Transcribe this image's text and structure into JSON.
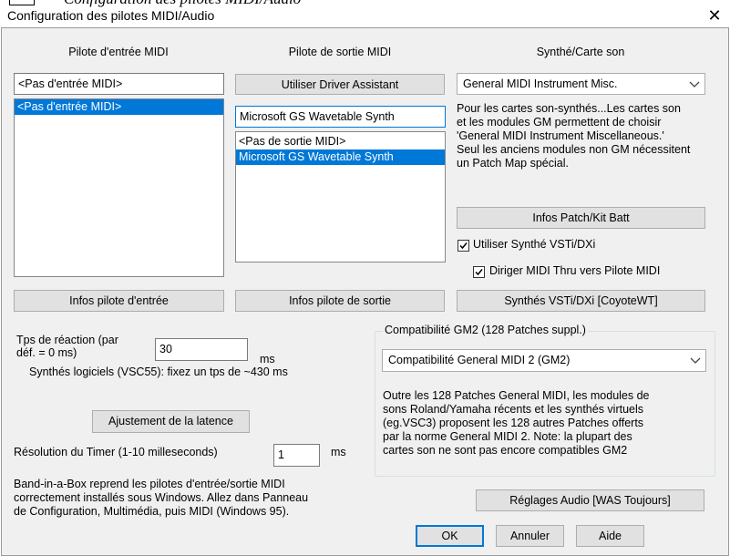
{
  "cut_caption": "Configuration des pilotes MIDI/Audio",
  "window": {
    "title": "Configuration des pilotes MIDI/Audio",
    "close_glyph": "✕"
  },
  "midi_in": {
    "header": "Pilote d'entrée MIDI",
    "value": "<Pas d'entrée MIDI>",
    "items": [
      "<Pas d'entrée MIDI>"
    ],
    "info_button": "Infos pilote d'entrée"
  },
  "midi_out": {
    "header": "Pilote de sortie MIDI",
    "assistant_button": "Utiliser Driver Assistant",
    "value": "Microsoft GS Wavetable Synth",
    "items": [
      "<Pas de sortie MIDI>",
      "Microsoft GS Wavetable Synth"
    ],
    "info_button": "Infos pilote de sortie"
  },
  "synth": {
    "header": "Synthé/Carte son",
    "selected": "General MIDI Instrument Misc.",
    "note_lines": [
      "Pour les cartes son-synthés...Les cartes son",
      "et les modules GM permettent de choisir",
      "'General MIDI  Instrument Miscellaneous.'",
      "Seul les anciens modules non GM nécessitent",
      "un Patch Map spécial."
    ],
    "patch_button": "Infos Patch/Kit Batt",
    "use_vst_label": "Utiliser Synthé VSTi/DXi",
    "use_vst_checked": true,
    "thru_label": "Diriger MIDI Thru vers Pilote MIDI",
    "thru_checked": true,
    "vst_button": "Synthés VSTi/DXi [CoyoteWT]"
  },
  "latency": {
    "label_line1": "Tps de réaction (par",
    "label_line2": "déf. = 0 ms)",
    "value": "30",
    "unit": "ms",
    "hint": "Synthés logiciels (VSC55): fixez un tps de ~430 ms",
    "adjust_button": "Ajustement de la latence"
  },
  "timer": {
    "label": "Résolution du Timer (1-10 milleseconds)",
    "value": "1",
    "unit": "ms"
  },
  "footer_note_lines": [
    "Band-in-a-Box reprend les pilotes d'entrée/sortie MIDI",
    "correctement installés sous Windows. Allez dans Panneau",
    "de Configuration, Multimédia, puis MIDI (Windows 95)."
  ],
  "gm2": {
    "group_label": "Compatibilité GM2 (128 Patches suppl.)",
    "selected": "Compatibilité General MIDI 2 (GM2)",
    "note_lines": [
      "Outre les 128 Patches General MIDI, les modules de",
      "sons Roland/Yamaha récents et les synthés virtuels",
      "(eg.VSC3) proposent les 128 autres Patches offerts",
      "par la norme General MIDI 2. Note: la plupart des",
      "cartes son ne sont pas encore compatibles GM2"
    ]
  },
  "buttons": {
    "audio": "Réglages Audio [WAS Toujours]",
    "ok": "OK",
    "cancel": "Annuler",
    "help": "Aide"
  },
  "colors": {
    "selection": "#0078d7",
    "dialog_bg": "#f0f0f0",
    "button_bg": "#e1e1e1"
  }
}
